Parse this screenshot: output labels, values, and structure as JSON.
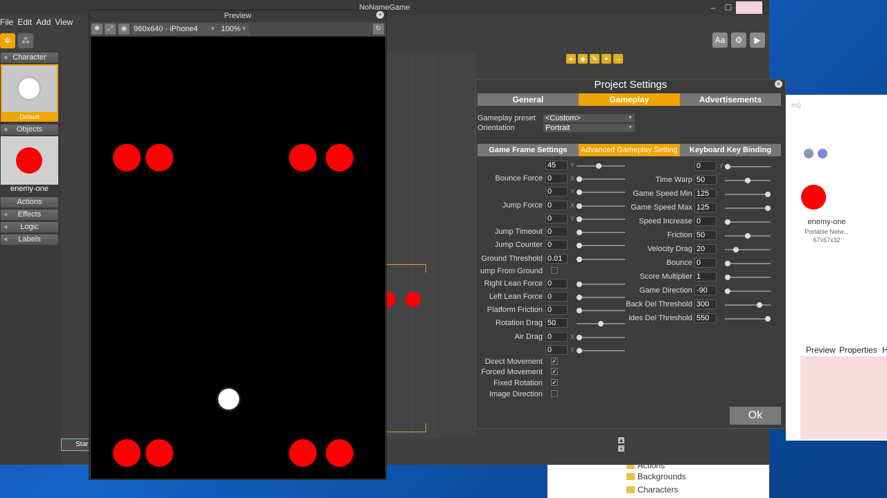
{
  "app": {
    "title": "NoNameGame",
    "menu": [
      "File",
      "Edit",
      "Add",
      "View"
    ],
    "right_buttons": [
      "Aa",
      "⚙",
      "▶"
    ],
    "start_label": "Start"
  },
  "left_panel": {
    "character_header": "Character",
    "character_label": "Default",
    "objects_header": "Objects",
    "object_label": "enemy-one",
    "sections": [
      "Actions",
      "Effects",
      "Logic",
      "Labels"
    ]
  },
  "preview": {
    "title": "Preview",
    "device": "960x640 - iPhone4",
    "zoom": "100%"
  },
  "dialog": {
    "title": "Project Settings",
    "tabs": [
      "General",
      "Gameplay",
      "Advertisements"
    ],
    "active_tab": "Gameplay",
    "preset_label": "Gameplay preset",
    "preset_value": "<Custom>",
    "orientation_label": "Orientation",
    "orientation_value": "Portrait",
    "subtabs": [
      "Game Frame Settings",
      "Advanced Gameplay Setting",
      "Keyboard Key Binding"
    ],
    "active_subtab": "Advanced Gameplay Setting",
    "left_fields": [
      {
        "label": "",
        "value": "45",
        "axis": "Y",
        "level": 0.45
      },
      {
        "label": "Bounce Force",
        "value": "0",
        "axis": "X",
        "level": 0
      },
      {
        "label": "",
        "value": "0",
        "axis": "Y",
        "level": 0
      },
      {
        "label": "Jump Force",
        "value": "0",
        "axis": "X",
        "level": 0
      },
      {
        "label": "",
        "value": "0",
        "axis": "Y",
        "level": 0
      },
      {
        "label": "Jump Timeout",
        "value": "0",
        "axis": "",
        "level": 0
      },
      {
        "label": "Jump Counter",
        "value": "0",
        "axis": "",
        "level": 0
      },
      {
        "label": "Ground Threshold",
        "value": "0.01",
        "axis": "",
        "level": 0
      }
    ],
    "jump_from_ground_label": "ump From Ground",
    "left_fields2": [
      {
        "label": "Right Lean Force",
        "value": "0",
        "axis": "",
        "level": 0
      },
      {
        "label": "Left Lean Force",
        "value": "0",
        "axis": "",
        "level": 0
      },
      {
        "label": "Platform Friction",
        "value": "0",
        "axis": "",
        "level": 0
      },
      {
        "label": "Rotation Drag",
        "value": "50",
        "axis": "",
        "level": 0.5
      },
      {
        "label": "Air Drag",
        "value": "0",
        "axis": "X",
        "level": 0
      },
      {
        "label": "",
        "value": "0",
        "axis": "Y",
        "level": 0
      }
    ],
    "checkboxes": [
      {
        "label": "Direct Movement",
        "checked": true
      },
      {
        "label": "Forced Movement",
        "checked": true
      },
      {
        "label": "Fixed Rotation",
        "checked": true
      },
      {
        "label": "Image Direction",
        "checked": false
      }
    ],
    "right_fields": [
      {
        "label": "",
        "value": "0",
        "axis": "Y",
        "level": 0
      },
      {
        "label": "Time Warp",
        "value": "50",
        "level": 0.5
      },
      {
        "label": "Game Speed Min",
        "value": "125",
        "level": 1
      },
      {
        "label": "Game Speed Max",
        "value": "125",
        "level": 1
      },
      {
        "label": "Speed Increase",
        "value": "0",
        "level": 0
      },
      {
        "label": "Friction",
        "value": "50",
        "level": 0.5
      },
      {
        "label": "Velocity Drag",
        "value": "20",
        "level": 0.2
      },
      {
        "label": "Bounce",
        "value": "0",
        "level": 0
      },
      {
        "label": "Score Multiplier",
        "value": "1",
        "level": 0
      },
      {
        "label": "Game Direction",
        "value": "-90",
        "level": 0
      },
      {
        "label": "Back Del Threshold",
        "value": "300",
        "level": 0.8
      },
      {
        "label": "ides Del Threshold",
        "value": "550",
        "level": 1
      }
    ],
    "ok_label": "Ok"
  },
  "side": {
    "asset_name": "enemy-one",
    "asset_type": "Portable Netw...",
    "asset_size": "67x67x32",
    "tabs": [
      "Preview",
      "Properties",
      "H"
    ],
    "frag": "es)"
  },
  "explorer": {
    "items": [
      "Actions",
      "Backgrounds",
      "Characters"
    ]
  },
  "colors": {
    "accent": "#f0a400",
    "enemy": "#ff0000",
    "dialog_bg": "#3c3c3c"
  }
}
